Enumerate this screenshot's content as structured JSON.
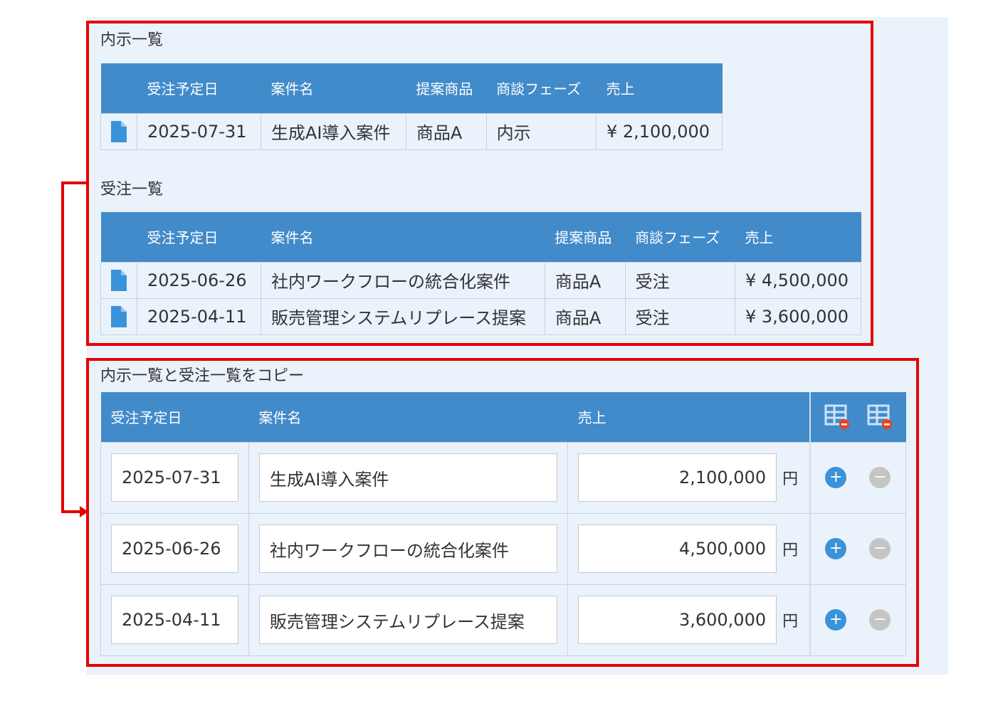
{
  "naiji": {
    "title": "内示一覧",
    "headers": [
      "受注予定日",
      "案件名",
      "提案商品",
      "商談フェーズ",
      "売上"
    ],
    "rows": [
      {
        "date": "2025-07-31",
        "name": "生成AI導入案件",
        "product": "商品A",
        "phase": "内示",
        "sales": "¥ 2,100,000"
      }
    ]
  },
  "juchu": {
    "title": "受注一覧",
    "headers": [
      "受注予定日",
      "案件名",
      "提案商品",
      "商談フェーズ",
      "売上"
    ],
    "rows": [
      {
        "date": "2025-06-26",
        "name": "社内ワークフローの統合化案件",
        "product": "商品A",
        "phase": "受注",
        "sales": "¥ 4,500,000"
      },
      {
        "date": "2025-04-11",
        "name": "販売管理システムリプレース提案",
        "product": "商品A",
        "phase": "受注",
        "sales": "¥ 3,600,000"
      }
    ]
  },
  "copy": {
    "title": "内示一覧と受注一覧をコピー",
    "headers": [
      "受注予定日",
      "案件名",
      "売上"
    ],
    "unit": "円",
    "rows": [
      {
        "date": "2025-07-31",
        "name": "生成AI導入案件",
        "amount": "2,100,000"
      },
      {
        "date": "2025-06-26",
        "name": "社内ワークフローの統合化案件",
        "amount": "4,500,000"
      },
      {
        "date": "2025-04-11",
        "name": "販売管理システムリプレース提案",
        "amount": "3,600,000"
      }
    ]
  },
  "icons": {
    "doc": "document-icon",
    "table_delete": "table-delete-icon",
    "add_row": "add-row-icon",
    "remove_row": "remove-row-icon"
  },
  "colors": {
    "header_blue": "#428bca",
    "panel_bg": "#eaf2fb",
    "annotation_red": "#e60000",
    "add_blue": "#3a93d8",
    "remove_gray": "#c5c5c5"
  }
}
